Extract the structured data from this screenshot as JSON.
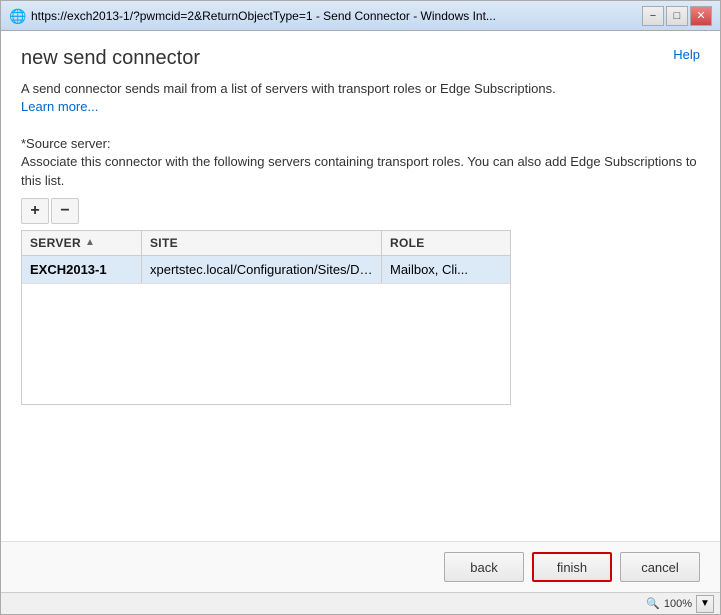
{
  "window": {
    "title": "https://exch2013-1/?pwmcid=2&ReturnObjectType=1 - Send Connector - Windows Int...",
    "minimize_label": "−",
    "restore_label": "□",
    "close_label": "✕"
  },
  "header": {
    "help_label": "Help",
    "page_title": "new send connector"
  },
  "description": {
    "text": "A send connector sends mail from a list of servers with transport roles or Edge Subscriptions.",
    "learn_more": "Learn more..."
  },
  "source_server": {
    "label": "*Source server:",
    "description": "Associate this connector with the following servers containing transport roles. You can also add Edge Subscriptions to this list."
  },
  "toolbar": {
    "add_label": "+",
    "remove_label": "−"
  },
  "table": {
    "columns": [
      {
        "key": "server",
        "label": "SERVER",
        "sort": true
      },
      {
        "key": "site",
        "label": "SITE",
        "sort": false
      },
      {
        "key": "role",
        "label": "ROLE",
        "sort": false
      }
    ],
    "rows": [
      {
        "server": "EXCH2013-1",
        "site": "xpertstec.local/Configuration/Sites/Default-Firs...",
        "role": "Mailbox, Cli..."
      }
    ]
  },
  "buttons": {
    "back_label": "back",
    "finish_label": "finish",
    "cancel_label": "cancel"
  },
  "status_bar": {
    "zoom": "100%"
  }
}
